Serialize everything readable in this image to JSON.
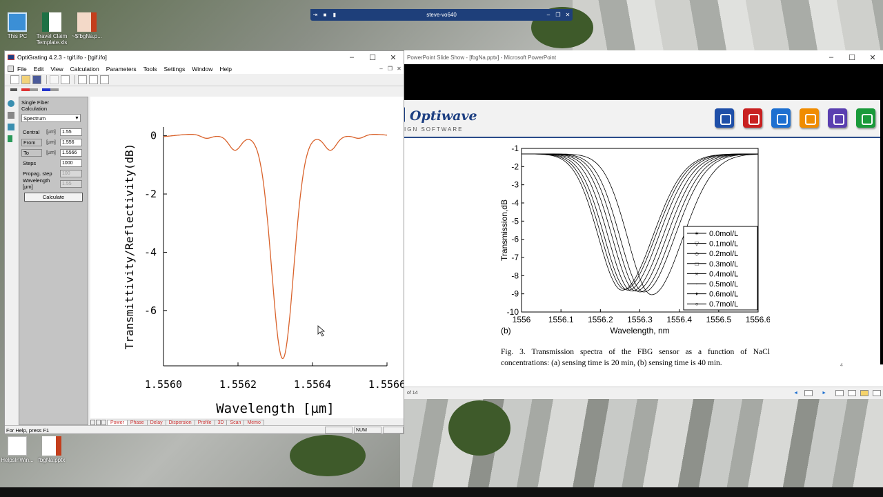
{
  "desktop": {
    "icons": [
      {
        "label": "This PC"
      },
      {
        "label": "Travel Claim Template.xls"
      },
      {
        "label": "~$fbgNa.p..."
      },
      {
        "label": "HelpsInWin..."
      },
      {
        "label": "fbgNa.pptx"
      }
    ]
  },
  "remote_bar": {
    "title": "steve-vo640"
  },
  "powerpoint": {
    "title": "PowerPoint Slide Show - [fbgNa.pptx] - Microsoft PowerPoint",
    "logo": "Optiwave",
    "logo_sub": "IGN SOFTWARE",
    "caption": "Fig. 3. Transmission spectra of the FBG sensor as a function of NaCl concentrations: (a) sensing time is 20 min, (b) sensing time is 40 min.",
    "slide_number": "4",
    "status": "of 14",
    "icon_colors": [
      "#1f4fa8",
      "#c82020",
      "#1d6fd0",
      "#f08c00",
      "#5a3fb0",
      "#1a9a3a"
    ]
  },
  "figure": {
    "chart_data": {
      "type": "line",
      "xlabel": "Wavelength, nm",
      "ylabel": "Transmission,dB",
      "panel_label": "(b)",
      "xlim": [
        1556,
        1556.6
      ],
      "ylim": [
        -10,
        -1
      ],
      "xticks": [
        "1556",
        "1556.1",
        "1556.2",
        "1556.3",
        "1556.4",
        "1556.5",
        "1556.6"
      ],
      "yticks": [
        "-1",
        "-2",
        "-3",
        "-4",
        "-5",
        "-6",
        "-7",
        "-8",
        "-9",
        "-10"
      ],
      "series": [
        {
          "name": "0.0mol/L",
          "center": 1556.255,
          "min": -8.8
        },
        {
          "name": "0.1mol/L",
          "center": 1556.262,
          "min": -8.75
        },
        {
          "name": "0.2mol/L",
          "center": 1556.27,
          "min": -8.8
        },
        {
          "name": "0.3mol/L",
          "center": 1556.28,
          "min": -8.85
        },
        {
          "name": "0.4mol/L",
          "center": 1556.29,
          "min": -8.85
        },
        {
          "name": "0.5mol/L",
          "center": 1556.3,
          "min": -8.9
        },
        {
          "name": "0.6mol/L",
          "center": 1556.31,
          "min": -8.9
        },
        {
          "name": "0.7mol/L",
          "center": 1556.33,
          "min": -9.05
        }
      ],
      "legend": "bottom-right"
    }
  },
  "opti": {
    "title": "OptiGrating 4.2.3 - tgif.ifo - [tgif.ifo]",
    "menu": [
      "File",
      "Edit",
      "View",
      "Calculation",
      "Parameters",
      "Tools",
      "Settings",
      "Window",
      "Help"
    ],
    "panel": {
      "heading1": "Single Fiber",
      "heading2": "Calculation",
      "mode": "Spectrum",
      "rows": [
        {
          "label": "Central",
          "unit": "[µm]",
          "value": "1.55"
        },
        {
          "label": "From",
          "unit": "[µm]",
          "value": "1.556"
        },
        {
          "label": "To",
          "unit": "[µm]",
          "value": "1.5566"
        },
        {
          "label": "Steps",
          "unit": "",
          "value": "1000"
        }
      ],
      "propag_label": "Propag. step",
      "propag_value": "100",
      "wl_label": "Wavelength [µm]",
      "wl_value": "1.55",
      "calc_button": "Calculate"
    },
    "tabs": [
      "Power",
      "Phase",
      "Delay",
      "Dispersion",
      "Profile",
      "3D",
      "Scan",
      "Memo"
    ],
    "status": "For Help, press F1",
    "num": "NUM",
    "plot": {
      "chart_data": {
        "type": "line",
        "xlabel": "Wavelength [µm]",
        "ylabel": "Transmittivity/Reflectivity(dB)",
        "xlim": [
          1.556,
          1.5566
        ],
        "ylim": [
          -7.9,
          0.3
        ],
        "xticks": [
          "1.5560",
          "1.5562",
          "1.5564",
          "1.5566"
        ],
        "yticks": [
          "0",
          "-2",
          "-4",
          "-6"
        ],
        "series": [
          {
            "center": 1.55632,
            "min": -7.7,
            "color": "#d9622b"
          }
        ]
      }
    }
  }
}
